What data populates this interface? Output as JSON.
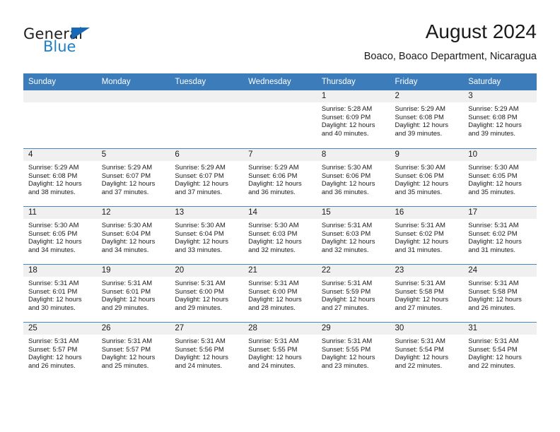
{
  "brand": {
    "name_dark": "General",
    "name_blue": "Blue",
    "accent_blue": "#1e7fc9",
    "triangle_blue": "#1569b6"
  },
  "header": {
    "title": "August 2024",
    "subtitle": "Boaco, Boaco Department, Nicaragua"
  },
  "calendar": {
    "header_bg": "#3c7cba",
    "daynum_bg": "#f0f0f0",
    "rule_color": "#4a87c0",
    "weekdays": [
      "Sunday",
      "Monday",
      "Tuesday",
      "Wednesday",
      "Thursday",
      "Friday",
      "Saturday"
    ],
    "weeks": [
      [
        {
          "day": "",
          "sunrise": "",
          "sunset": "",
          "daylight1": "",
          "daylight2": ""
        },
        {
          "day": "",
          "sunrise": "",
          "sunset": "",
          "daylight1": "",
          "daylight2": ""
        },
        {
          "day": "",
          "sunrise": "",
          "sunset": "",
          "daylight1": "",
          "daylight2": ""
        },
        {
          "day": "",
          "sunrise": "",
          "sunset": "",
          "daylight1": "",
          "daylight2": ""
        },
        {
          "day": "1",
          "sunrise": "Sunrise: 5:28 AM",
          "sunset": "Sunset: 6:09 PM",
          "daylight1": "Daylight: 12 hours",
          "daylight2": "and 40 minutes."
        },
        {
          "day": "2",
          "sunrise": "Sunrise: 5:29 AM",
          "sunset": "Sunset: 6:08 PM",
          "daylight1": "Daylight: 12 hours",
          "daylight2": "and 39 minutes."
        },
        {
          "day": "3",
          "sunrise": "Sunrise: 5:29 AM",
          "sunset": "Sunset: 6:08 PM",
          "daylight1": "Daylight: 12 hours",
          "daylight2": "and 39 minutes."
        }
      ],
      [
        {
          "day": "4",
          "sunrise": "Sunrise: 5:29 AM",
          "sunset": "Sunset: 6:08 PM",
          "daylight1": "Daylight: 12 hours",
          "daylight2": "and 38 minutes."
        },
        {
          "day": "5",
          "sunrise": "Sunrise: 5:29 AM",
          "sunset": "Sunset: 6:07 PM",
          "daylight1": "Daylight: 12 hours",
          "daylight2": "and 37 minutes."
        },
        {
          "day": "6",
          "sunrise": "Sunrise: 5:29 AM",
          "sunset": "Sunset: 6:07 PM",
          "daylight1": "Daylight: 12 hours",
          "daylight2": "and 37 minutes."
        },
        {
          "day": "7",
          "sunrise": "Sunrise: 5:29 AM",
          "sunset": "Sunset: 6:06 PM",
          "daylight1": "Daylight: 12 hours",
          "daylight2": "and 36 minutes."
        },
        {
          "day": "8",
          "sunrise": "Sunrise: 5:30 AM",
          "sunset": "Sunset: 6:06 PM",
          "daylight1": "Daylight: 12 hours",
          "daylight2": "and 36 minutes."
        },
        {
          "day": "9",
          "sunrise": "Sunrise: 5:30 AM",
          "sunset": "Sunset: 6:06 PM",
          "daylight1": "Daylight: 12 hours",
          "daylight2": "and 35 minutes."
        },
        {
          "day": "10",
          "sunrise": "Sunrise: 5:30 AM",
          "sunset": "Sunset: 6:05 PM",
          "daylight1": "Daylight: 12 hours",
          "daylight2": "and 35 minutes."
        }
      ],
      [
        {
          "day": "11",
          "sunrise": "Sunrise: 5:30 AM",
          "sunset": "Sunset: 6:05 PM",
          "daylight1": "Daylight: 12 hours",
          "daylight2": "and 34 minutes."
        },
        {
          "day": "12",
          "sunrise": "Sunrise: 5:30 AM",
          "sunset": "Sunset: 6:04 PM",
          "daylight1": "Daylight: 12 hours",
          "daylight2": "and 34 minutes."
        },
        {
          "day": "13",
          "sunrise": "Sunrise: 5:30 AM",
          "sunset": "Sunset: 6:04 PM",
          "daylight1": "Daylight: 12 hours",
          "daylight2": "and 33 minutes."
        },
        {
          "day": "14",
          "sunrise": "Sunrise: 5:30 AM",
          "sunset": "Sunset: 6:03 PM",
          "daylight1": "Daylight: 12 hours",
          "daylight2": "and 32 minutes."
        },
        {
          "day": "15",
          "sunrise": "Sunrise: 5:31 AM",
          "sunset": "Sunset: 6:03 PM",
          "daylight1": "Daylight: 12 hours",
          "daylight2": "and 32 minutes."
        },
        {
          "day": "16",
          "sunrise": "Sunrise: 5:31 AM",
          "sunset": "Sunset: 6:02 PM",
          "daylight1": "Daylight: 12 hours",
          "daylight2": "and 31 minutes."
        },
        {
          "day": "17",
          "sunrise": "Sunrise: 5:31 AM",
          "sunset": "Sunset: 6:02 PM",
          "daylight1": "Daylight: 12 hours",
          "daylight2": "and 31 minutes."
        }
      ],
      [
        {
          "day": "18",
          "sunrise": "Sunrise: 5:31 AM",
          "sunset": "Sunset: 6:01 PM",
          "daylight1": "Daylight: 12 hours",
          "daylight2": "and 30 minutes."
        },
        {
          "day": "19",
          "sunrise": "Sunrise: 5:31 AM",
          "sunset": "Sunset: 6:01 PM",
          "daylight1": "Daylight: 12 hours",
          "daylight2": "and 29 minutes."
        },
        {
          "day": "20",
          "sunrise": "Sunrise: 5:31 AM",
          "sunset": "Sunset: 6:00 PM",
          "daylight1": "Daylight: 12 hours",
          "daylight2": "and 29 minutes."
        },
        {
          "day": "21",
          "sunrise": "Sunrise: 5:31 AM",
          "sunset": "Sunset: 6:00 PM",
          "daylight1": "Daylight: 12 hours",
          "daylight2": "and 28 minutes."
        },
        {
          "day": "22",
          "sunrise": "Sunrise: 5:31 AM",
          "sunset": "Sunset: 5:59 PM",
          "daylight1": "Daylight: 12 hours",
          "daylight2": "and 27 minutes."
        },
        {
          "day": "23",
          "sunrise": "Sunrise: 5:31 AM",
          "sunset": "Sunset: 5:58 PM",
          "daylight1": "Daylight: 12 hours",
          "daylight2": "and 27 minutes."
        },
        {
          "day": "24",
          "sunrise": "Sunrise: 5:31 AM",
          "sunset": "Sunset: 5:58 PM",
          "daylight1": "Daylight: 12 hours",
          "daylight2": "and 26 minutes."
        }
      ],
      [
        {
          "day": "25",
          "sunrise": "Sunrise: 5:31 AM",
          "sunset": "Sunset: 5:57 PM",
          "daylight1": "Daylight: 12 hours",
          "daylight2": "and 26 minutes."
        },
        {
          "day": "26",
          "sunrise": "Sunrise: 5:31 AM",
          "sunset": "Sunset: 5:57 PM",
          "daylight1": "Daylight: 12 hours",
          "daylight2": "and 25 minutes."
        },
        {
          "day": "27",
          "sunrise": "Sunrise: 5:31 AM",
          "sunset": "Sunset: 5:56 PM",
          "daylight1": "Daylight: 12 hours",
          "daylight2": "and 24 minutes."
        },
        {
          "day": "28",
          "sunrise": "Sunrise: 5:31 AM",
          "sunset": "Sunset: 5:55 PM",
          "daylight1": "Daylight: 12 hours",
          "daylight2": "and 24 minutes."
        },
        {
          "day": "29",
          "sunrise": "Sunrise: 5:31 AM",
          "sunset": "Sunset: 5:55 PM",
          "daylight1": "Daylight: 12 hours",
          "daylight2": "and 23 minutes."
        },
        {
          "day": "30",
          "sunrise": "Sunrise: 5:31 AM",
          "sunset": "Sunset: 5:54 PM",
          "daylight1": "Daylight: 12 hours",
          "daylight2": "and 22 minutes."
        },
        {
          "day": "31",
          "sunrise": "Sunrise: 5:31 AM",
          "sunset": "Sunset: 5:54 PM",
          "daylight1": "Daylight: 12 hours",
          "daylight2": "and 22 minutes."
        }
      ]
    ]
  }
}
